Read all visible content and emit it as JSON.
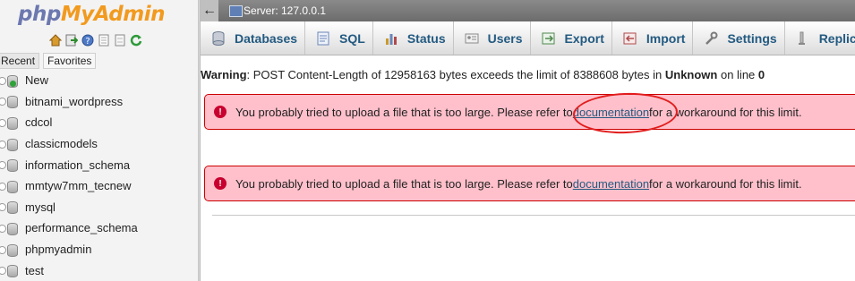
{
  "logo": {
    "part1": "php",
    "part2": "MyAdmin"
  },
  "nav_icons": [
    "home-icon",
    "exit-icon",
    "help-icon",
    "docs-icon",
    "reload-icon"
  ],
  "tabs": {
    "recent": "Recent",
    "favorites": "Favorites"
  },
  "databases": [
    {
      "label": "New",
      "kind": "new"
    },
    {
      "label": "bitnami_wordpress"
    },
    {
      "label": "cdcol"
    },
    {
      "label": "classicmodels"
    },
    {
      "label": "information_schema"
    },
    {
      "label": "mmtyw7mm_tecnew"
    },
    {
      "label": "mysql"
    },
    {
      "label": "performance_schema"
    },
    {
      "label": "phpmyadmin"
    },
    {
      "label": "test"
    }
  ],
  "topbar": {
    "back": "←",
    "server": "Server: 127.0.0.1"
  },
  "menu": [
    {
      "label": "Databases",
      "icon": "databases-icon",
      "color": "#6b7a90"
    },
    {
      "label": "SQL",
      "icon": "sql-icon",
      "color": "#6a86b8"
    },
    {
      "label": "Status",
      "icon": "status-icon",
      "color": "#c99a2e"
    },
    {
      "label": "Users",
      "icon": "users-icon",
      "color": "#8a8a8a"
    },
    {
      "label": "Export",
      "icon": "export-icon",
      "color": "#4f8a4f"
    },
    {
      "label": "Import",
      "icon": "import-icon",
      "color": "#b04a4a"
    },
    {
      "label": "Settings",
      "icon": "settings-icon",
      "color": "#7a7a7a"
    },
    {
      "label": "Replication",
      "icon": "replication-icon",
      "color": "#8a8a8a"
    }
  ],
  "warning": {
    "label": "Warning",
    "text": ": POST Content-Length of 12958163 bytes exceeds the limit of 8388608 bytes in ",
    "file": "Unknown",
    "mid": " on line ",
    "line": "0"
  },
  "errors": [
    {
      "before": "You probably tried to upload a file that is too large. Please refer to ",
      "link": "documentation",
      "after": " for a workaround for this limit."
    },
    {
      "before": "You probably tried to upload a file that is too large. Please refer to ",
      "link": "documentation",
      "after": " for a workaround for this limit."
    }
  ],
  "colors": {
    "accent": "#235a81",
    "error_bg": "#ffc0cb",
    "error_border": "#cc0000",
    "annotation": "#e21d1d"
  }
}
